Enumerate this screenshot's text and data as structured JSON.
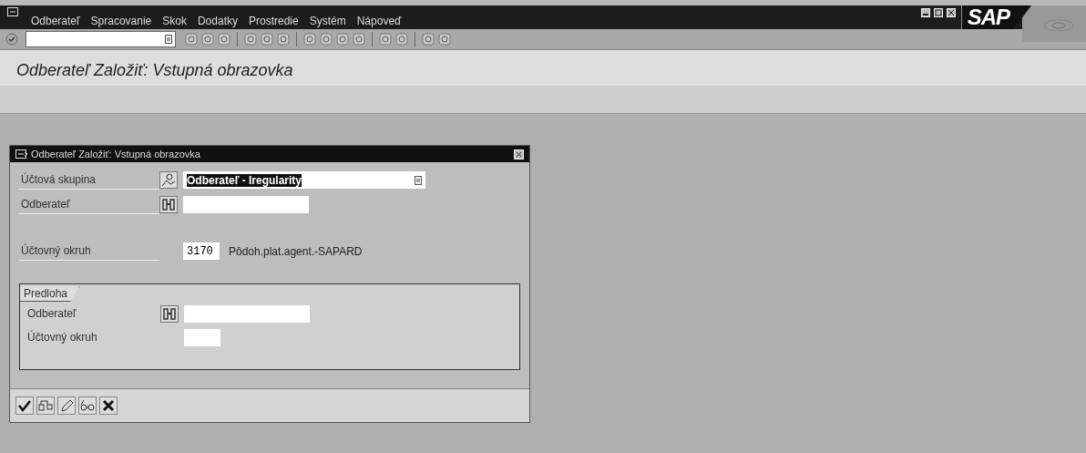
{
  "menu_bar": {
    "items": [
      {
        "label": "Odberateľ"
      },
      {
        "label": "Spracovanie"
      },
      {
        "label": "Skok"
      },
      {
        "label": "Dodatky"
      },
      {
        "label": "Prostredie"
      },
      {
        "label": "Systém"
      },
      {
        "label": "Nápoveď"
      }
    ],
    "logo": "SAP"
  },
  "screen_title": "Odberateľ Založiť: Vstupná obrazovka",
  "dialog": {
    "title": "Odberateľ Založiť: Vstupná obrazovka",
    "fields": [
      {
        "label": "Účtová skupina",
        "kind": "dropdown",
        "value": "Odberateľ - Iregularity"
      },
      {
        "label": "Odberateľ",
        "kind": "search"
      },
      {
        "label": "Účtovný okruh",
        "kind": "short",
        "value": "3170",
        "description": "Pôdoh.plat.agent.-SAPARD"
      }
    ],
    "group": {
      "title": "Predloha",
      "fields": [
        {
          "label": "Odberateľ",
          "kind": "search"
        },
        {
          "label": "Účtovný okruh",
          "kind": "short"
        }
      ]
    }
  }
}
